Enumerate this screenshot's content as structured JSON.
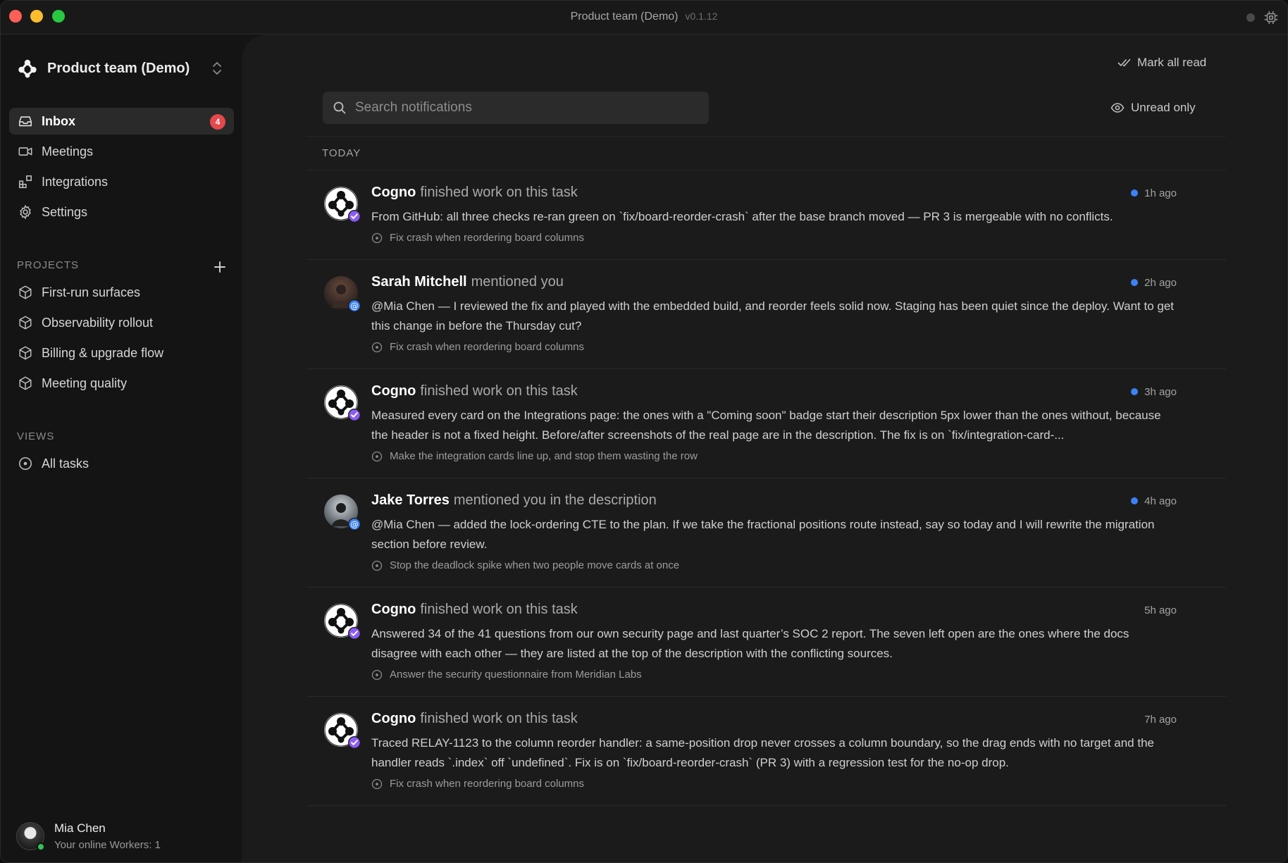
{
  "window": {
    "title": "Product team (Demo)",
    "version": "v0.1.12"
  },
  "sidebar": {
    "workspace": "Product team (Demo)",
    "nav": [
      {
        "label": "Inbox",
        "icon": "inbox-icon",
        "badge": "4",
        "active": true
      },
      {
        "label": "Meetings",
        "icon": "video-icon"
      },
      {
        "label": "Integrations",
        "icon": "integrations-icon"
      },
      {
        "label": "Settings",
        "icon": "gear-icon"
      }
    ],
    "projects_label": "PROJECTS",
    "projects": [
      {
        "label": "First-run surfaces",
        "icon": "cube-icon"
      },
      {
        "label": "Observability rollout",
        "icon": "cube-icon"
      },
      {
        "label": "Billing & upgrade flow",
        "icon": "cube-icon"
      },
      {
        "label": "Meeting quality",
        "icon": "cube-icon"
      }
    ],
    "views_label": "VIEWS",
    "views": [
      {
        "label": "All tasks",
        "icon": "circle-dot-icon"
      }
    ],
    "user": {
      "name": "Mia Chen",
      "status": "Your online Workers: 1"
    }
  },
  "main": {
    "mark_all_read": "Mark all read",
    "search_placeholder": "Search notifications",
    "unread_only": "Unread only",
    "group_label": "TODAY",
    "notifications": [
      {
        "actor": "Cogno",
        "action": "finished work on this task",
        "time": "1h ago",
        "unread": true,
        "avatar": "cogno-logo-icon",
        "kind": "check",
        "body": "From GitHub: all three checks re-ran green on `fix/board-reorder-crash` after the base branch moved — PR 3 is mergeable with no conflicts.",
        "task": "Fix crash when reordering board columns"
      },
      {
        "actor": "Sarah Mitchell",
        "action": "mentioned you",
        "time": "2h ago",
        "unread": true,
        "avatar": "photo-avatar",
        "kind": "mention",
        "body": "@Mia Chen — I reviewed the fix and played with the embedded build, and reorder feels solid now. Staging has been quiet since the deploy. Want to get this change in before the Thursday cut?",
        "task": "Fix crash when reordering board columns"
      },
      {
        "actor": "Cogno",
        "action": "finished work on this task",
        "time": "3h ago",
        "unread": true,
        "avatar": "cogno-logo-icon",
        "kind": "check",
        "body": "Measured every card on the Integrations page: the ones with a \"Coming soon\" badge start their description 5px lower than the ones without, because the header is not a fixed height. Before/after screenshots of the real page are in the description. The fix is on `fix/integration-card-...",
        "task": "Make the integration cards line up, and stop them wasting the row"
      },
      {
        "actor": "Jake Torres",
        "action": "mentioned you in the description",
        "time": "4h ago",
        "unread": true,
        "avatar": "photo-avatar",
        "kind": "mention",
        "body": "@Mia Chen — added the lock-ordering CTE to the plan. If we take the fractional positions route instead, say so today and I will rewrite the migration section before review.",
        "task": "Stop the deadlock spike when two people move cards at once"
      },
      {
        "actor": "Cogno",
        "action": "finished work on this task",
        "time": "5h ago",
        "unread": false,
        "avatar": "cogno-logo-icon",
        "kind": "check",
        "body": "Answered 34 of the 41 questions from our own security page and last quarter’s SOC 2 report. The seven left open are the ones where the docs disagree with each other — they are listed at the top of the description with the conflicting sources.",
        "task": "Answer the security questionnaire from Meridian Labs"
      },
      {
        "actor": "Cogno",
        "action": "finished work on this task",
        "time": "7h ago",
        "unread": false,
        "avatar": "cogno-logo-icon",
        "kind": "check",
        "body": "Traced RELAY-1123 to the column reorder handler: a same-position drop never crosses a column boundary, so the drag ends with no target and the handler reads `.index` off `undefined`. Fix is on `fix/board-reorder-crash` (PR 3) with a regression test for the no-op drop.",
        "task": "Fix crash when reordering board columns"
      }
    ]
  },
  "colors": {
    "accent_unread": "#3b82f6",
    "badge_red": "#e5484d",
    "check_badge": "#8b5cf6",
    "mention_badge": "#3b82f6",
    "online": "#30c35a"
  }
}
